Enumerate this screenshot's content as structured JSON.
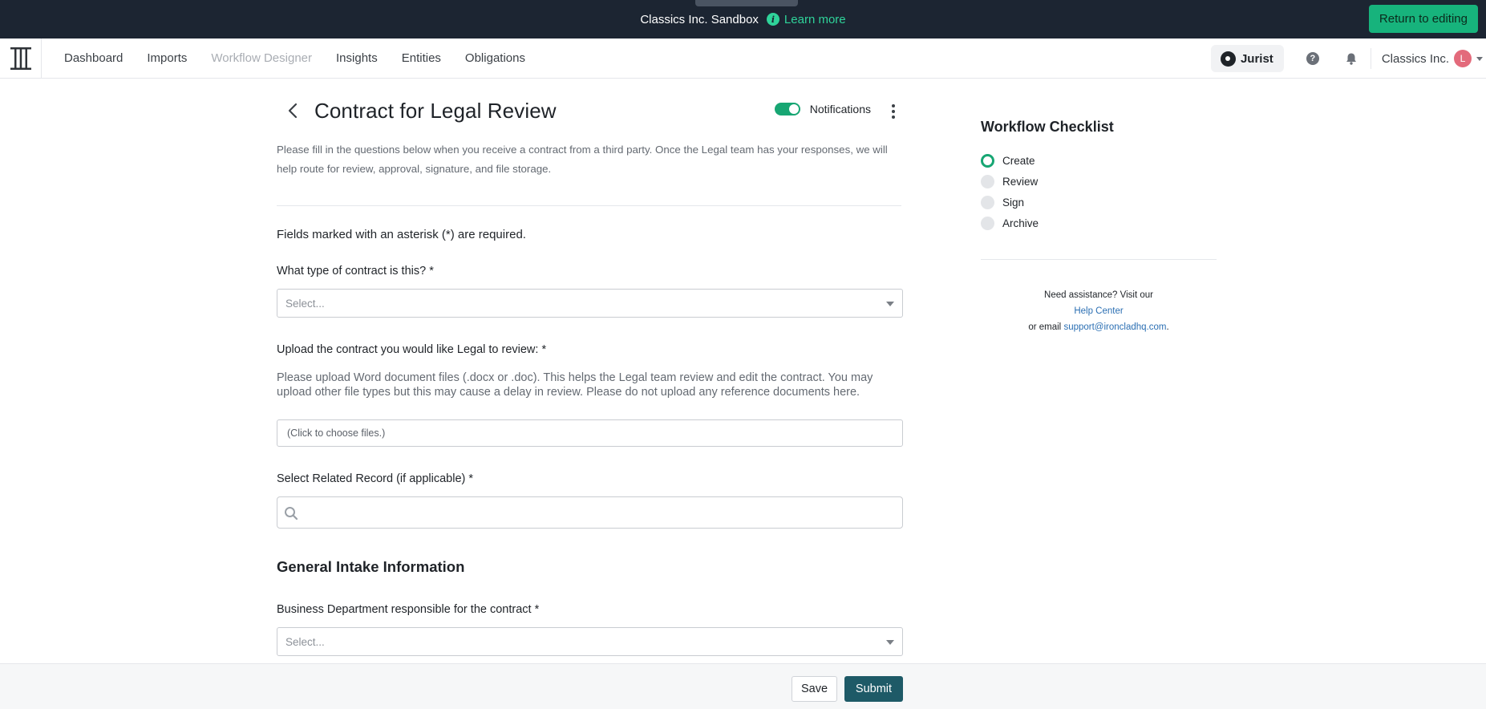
{
  "banner": {
    "title": "Classics Inc. Sandbox",
    "learn_more": "Learn more",
    "return_button": "Return to editing"
  },
  "nav": {
    "items": [
      {
        "label": "Dashboard",
        "muted": false
      },
      {
        "label": "Imports",
        "muted": false
      },
      {
        "label": "Workflow Designer",
        "muted": true
      },
      {
        "label": "Insights",
        "muted": false
      },
      {
        "label": "Entities",
        "muted": false
      },
      {
        "label": "Obligations",
        "muted": false
      }
    ],
    "jurist_label": "Jurist",
    "org_name": "Classics Inc.",
    "avatar_initial": "L"
  },
  "form": {
    "title": "Contract for Legal Review",
    "notifications_label": "Notifications",
    "notifications_on": true,
    "intro": "Please fill in the questions below when you receive a contract from a third party. Once the Legal team has your responses, we will help route for review, approval, signature, and file storage.",
    "required_note": "Fields marked with an asterisk (*) are required.",
    "q_contract_type": "What type of contract is this? *",
    "contract_type_placeholder": "Select...",
    "q_upload": "Upload the contract you would like Legal to review: *",
    "upload_help": "Please upload Word document files (.docx or .doc). This helps the Legal team review and edit the contract. You may upload other file types but this may cause a delay in review. Please do not upload any reference documents here.",
    "upload_placeholder": "(Click to choose files.)",
    "q_related_record": "Select Related Record (if applicable) *",
    "section_general": "General Intake Information",
    "q_department": "Business Department responsible for the contract *",
    "department_placeholder": "Select..."
  },
  "checklist": {
    "title": "Workflow Checklist",
    "steps": [
      "Create",
      "Review",
      "Sign",
      "Archive"
    ],
    "assist_line1": "Need assistance? Visit our",
    "help_center": "Help Center",
    "assist_or_email": "or email",
    "support_email": "support@ironcladhq.com",
    "period": "."
  },
  "footer": {
    "save": "Save",
    "submit": "Submit"
  },
  "colors": {
    "banner_bg": "#1c2532",
    "accent_green": "#17b37c",
    "submit_bg": "#1e5a67",
    "link_blue": "#2b6fb3"
  }
}
